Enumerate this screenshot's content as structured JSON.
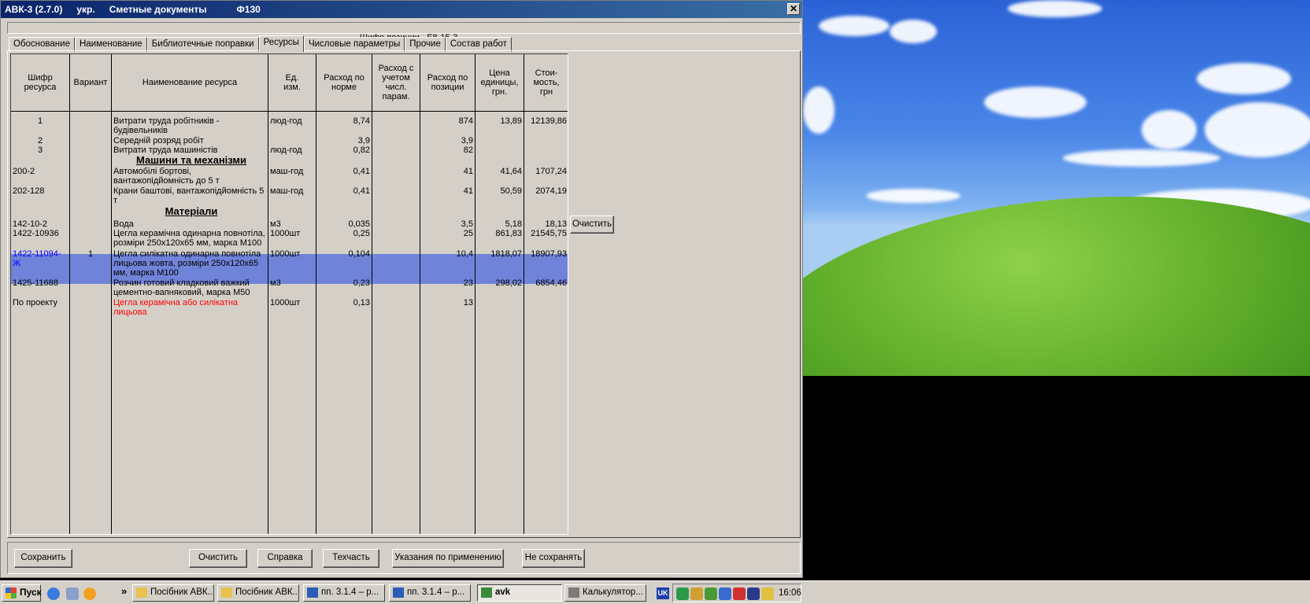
{
  "window": {
    "title_app": "АВК-3 (2.7.0)",
    "title_lang": "укр.",
    "title_doc": "Сметные документы",
    "title_form": "Ф130",
    "close": "✕"
  },
  "position": {
    "label": "Шифр позиции",
    "code": "Е8-15-3"
  },
  "tabs": [
    "Обоснование",
    "Наименование",
    "Библиотечные поправки",
    "Ресурсы",
    "Числовые параметры",
    "Прочие",
    "Состав работ"
  ],
  "active_tab": "Ресурсы",
  "columns": [
    "Шифр ресурса",
    "Вариант",
    "Наименование ресурса",
    "Ед. изм.",
    "Расход по норме",
    "Расход с учетом числ. парам.",
    "Расход по позиции",
    "Цена единицы, грн.",
    "Стои-мость, грн"
  ],
  "rows": [
    {
      "code": "1",
      "variant": "",
      "name": "Витрати труда робітників - будівельників",
      "unit": "люд-год",
      "norm": "8,74",
      "param": "",
      "pos": "874",
      "price": "13,89",
      "cost": "12139,86"
    },
    {
      "code": "2",
      "variant": "",
      "name": "Середній розряд робіт",
      "unit": "",
      "norm": "3,9",
      "param": "",
      "pos": "3,9",
      "price": "",
      "cost": ""
    },
    {
      "code": "3",
      "variant": "",
      "name": "Витрати труда машиністів",
      "unit": "люд-год",
      "norm": "0,82",
      "param": "",
      "pos": "82",
      "price": "",
      "cost": ""
    },
    {
      "code": "200-2",
      "variant": "",
      "name": "Автомобілі бортові, вантажопідйомність до 5 т",
      "unit": "маш-год",
      "norm": "0,41",
      "param": "",
      "pos": "41",
      "price": "41,64",
      "cost": "1707,24"
    },
    {
      "code": "202-128",
      "variant": "",
      "name": "Крани баштові, вантажопідйомність 5 т",
      "unit": "маш-год",
      "norm": "0,41",
      "param": "",
      "pos": "41",
      "price": "50,59",
      "cost": "2074,19"
    },
    {
      "code": "142-10-2",
      "variant": "",
      "name": "Вода",
      "unit": "м3",
      "norm": "0,035",
      "param": "",
      "pos": "3,5",
      "price": "5,18",
      "cost": "18,13"
    },
    {
      "code": "1422-10936",
      "variant": "",
      "name": "Цегла керамічна одинарна повнотіла, розміри 250х120х65 мм, марка М100",
      "unit": "1000шт",
      "norm": "0,25",
      "param": "",
      "pos": "25",
      "price": "861,83",
      "cost": "21545,75"
    },
    {
      "code": "1422-11094-Ж",
      "variant": "1",
      "name": "Цегла силікатна одинарна повнотіла лицьова жовта, розміри 250х120х65 мм, марка М100",
      "unit": "1000шт",
      "norm": "0,104",
      "param": "",
      "pos": "10,4",
      "price": "1818,07",
      "cost": "18907,93"
    },
    {
      "code": "1425-11688",
      "variant": "",
      "name": "Розчин готовий кладковий важкий цементно-вапняковий, марка М50",
      "unit": "м3",
      "norm": "0,23",
      "param": "",
      "pos": "23",
      "price": "298,02",
      "cost": "6854,46"
    },
    {
      "code": "По проекту",
      "variant": "",
      "name": "Цегла керамічна або силікатна лицьова",
      "unit": "1000шт",
      "norm": "0,13",
      "param": "",
      "pos": "13",
      "price": "",
      "cost": ""
    }
  ],
  "sections": {
    "machines": "Машини та механізми",
    "materials": "Матеріали"
  },
  "side_clear_button": "Очистить",
  "buttons": {
    "save": "Сохранить",
    "clear": "Очистить",
    "help": "Справка",
    "techpart": "Техчасть",
    "guidance": "Указания по применению",
    "dont_save": "Не сохранять"
  },
  "taskbar": {
    "start": "Пуск",
    "more": "»",
    "items": [
      {
        "label": "Посібник АВК...",
        "icon": "folder-icon",
        "color": "#e8c24a"
      },
      {
        "label": "Посібник АВК...",
        "icon": "folder-icon",
        "color": "#e8c24a"
      },
      {
        "label": "пп. 3.1.4 – р...",
        "icon": "word-doc-icon",
        "color": "#2b5db8"
      },
      {
        "label": "пп. 3.1.4 – р...",
        "icon": "word-doc-icon",
        "color": "#2b5db8"
      },
      {
        "label": "avk",
        "icon": "avk-app-icon",
        "color": "#3a8a3a"
      },
      {
        "label": "Калькулятор...",
        "icon": "calculator-icon",
        "color": "#7a7a7a"
      }
    ],
    "lang": "UK",
    "clock": "16:06"
  }
}
